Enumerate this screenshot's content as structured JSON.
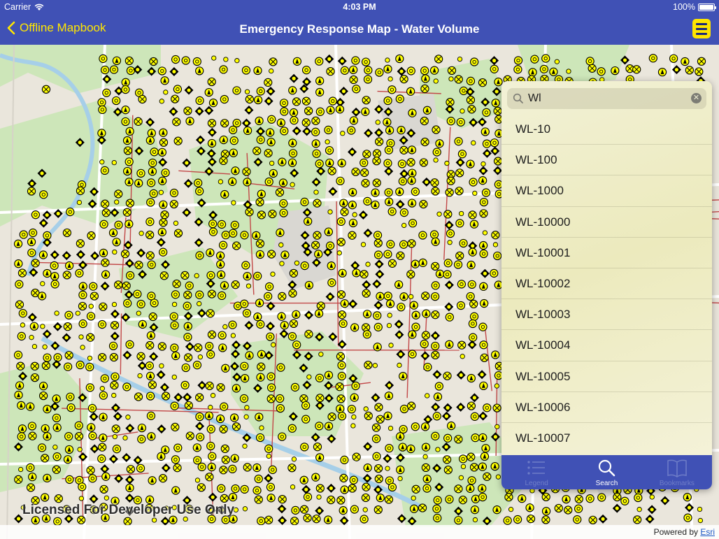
{
  "status_bar": {
    "carrier": "Carrier",
    "time": "4:03 PM",
    "battery": "100%",
    "battery_level": 1.0
  },
  "nav": {
    "back_label": "Offline Mapbook",
    "title": "Emergency Response Map - Water Volume",
    "icon": "menu-icon"
  },
  "map": {
    "watermark": "Licensed For Developer Use Only",
    "attribution_prefix": "Powered by ",
    "attribution_link": "Esri",
    "colors": {
      "feature_fill": "#ffff00",
      "feature_stroke": "#000000",
      "main_line": "#c24848",
      "land": "#eae6dc",
      "park": "#cde6b9",
      "water": "#a6cfe8",
      "road": "#ffffff"
    }
  },
  "search": {
    "query": "Wl",
    "clear_icon": "clear-icon",
    "results": [
      "WL-10",
      "WL-100",
      "WL-1000",
      "WL-10000",
      "WL-10001",
      "WL-10002",
      "WL-10003",
      "WL-10004",
      "WL-10005",
      "WL-10006",
      "WL-10007"
    ]
  },
  "tabs": [
    {
      "label": "Legend",
      "icon": "legend-icon",
      "selected": false
    },
    {
      "label": "Search",
      "icon": "search-icon",
      "selected": true
    },
    {
      "label": "Bookmarks",
      "icon": "bookmarks-icon",
      "selected": false
    }
  ]
}
